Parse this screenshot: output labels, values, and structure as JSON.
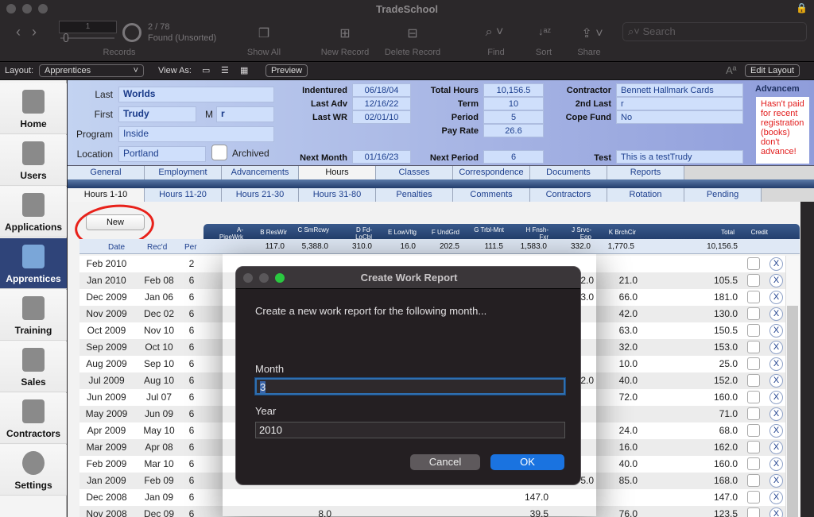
{
  "window": {
    "title": "TradeSchool"
  },
  "toolbar": {
    "record_number": "1",
    "found_count": "2 / 78",
    "found_status": "Found (Unsorted)",
    "records_label": "Records",
    "show_all_label": "Show All",
    "new_record_label": "New Record",
    "delete_record_label": "Delete Record",
    "find_label": "Find",
    "sort_label": "Sort",
    "share_label": "Share",
    "search_placeholder": "Search"
  },
  "layoutbar": {
    "layout_label": "Layout:",
    "layout_value": "Apprentices",
    "view_as_label": "View As:",
    "preview_label": "Preview",
    "edit_layout_label": "Edit Layout",
    "text_size_icon": "Aª"
  },
  "sidebar": {
    "items": [
      {
        "label": "Home",
        "icon": "house-icon"
      },
      {
        "label": "Users",
        "icon": "address-book-icon"
      },
      {
        "label": "Applications",
        "icon": "clipboard-icon"
      },
      {
        "label": "Apprentices",
        "icon": "id-badge-icon",
        "active": true
      },
      {
        "label": "Training",
        "icon": "certificate-icon"
      },
      {
        "label": "Sales",
        "icon": "basket-icon"
      },
      {
        "label": "Contractors",
        "icon": "briefcase-icon"
      },
      {
        "label": "Settings",
        "icon": "hammer-icon"
      }
    ]
  },
  "record": {
    "last_label": "Last",
    "last": "Worlds",
    "first_label": "First",
    "first": "Trudy",
    "middle_label": "M",
    "middle": "r",
    "program_label": "Program",
    "program": "Inside",
    "location_label": "Location",
    "location": "Portland",
    "archived_label": "Archived",
    "indentured_label": "Indentured",
    "indentured": "06/18/04",
    "last_adv_label": "Last Adv",
    "last_adv": "12/16/22",
    "last_wr_label": "Last WR",
    "last_wr": "02/01/10",
    "next_month_label": "Next Month",
    "next_month": "01/16/23",
    "total_hours_label": "Total Hours",
    "total_hours": "10,156.5",
    "term_label": "Term",
    "term": "10",
    "period_label": "Period",
    "period": "5",
    "pay_rate_label": "Pay Rate",
    "pay_rate": "26.6",
    "next_period_label": "Next Period",
    "next_period": "6",
    "contractor_label": "Contractor",
    "contractor": "Bennett Hallmark Cards",
    "second_last_label": "2nd Last",
    "second_last": "r",
    "cope_fund_label": "Cope Fund",
    "cope_fund": "No",
    "test_label": "Test",
    "test": "This is a testTrudy",
    "advancement_label": "Advancem",
    "advancement_note": "Hasn't paid for recent registration (books) don't advance!"
  },
  "tabs": [
    "General",
    "Employment",
    "Advancements",
    "Hours",
    "Classes",
    "Correspondence",
    "Documents",
    "Reports"
  ],
  "active_tab": "Hours",
  "subtabs": [
    "Hours 1-10",
    "Hours 11-20",
    "Hours 21-30",
    "Hours 31-80",
    "Penalties",
    "Comments",
    "Contractors",
    "Rotation",
    "Pending"
  ],
  "active_subtab": "Hours 1-10",
  "hours": {
    "new_label": "New",
    "columns": [
      "A-PipeWrk",
      "B ResWir",
      "C SmRcwy",
      "D Fd-LgCbl",
      "E LowVltg",
      "F UndGrd",
      "G Trbl-Mnt",
      "H Fnsh-Fxr",
      "J Srvc-Eqp",
      "K BrchCir",
      "Total",
      "Credit"
    ],
    "sub_headers": [
      "Date",
      "Rec'd",
      "Per"
    ],
    "totals": [
      "",
      "117.0",
      "5,388.0",
      "310.0",
      "16.0",
      "202.5",
      "111.5",
      "1,583.0",
      "332.0",
      "1,770.5",
      "10,156.5"
    ],
    "rows": [
      {
        "date": "Feb 2010",
        "recd": "",
        "per": "2",
        "j": "",
        "k": "",
        "total": ""
      },
      {
        "date": "Jan 2010",
        "recd": "Feb 08",
        "per": "6",
        "j": "2.0",
        "k": "21.0",
        "total": "105.5"
      },
      {
        "date": "Dec 2009",
        "recd": "Jan 06",
        "per": "6",
        "j": "3.0",
        "k": "66.0",
        "total": "181.0"
      },
      {
        "date": "Nov 2009",
        "recd": "Dec 02",
        "per": "6",
        "j": "",
        "k": "42.0",
        "total": "130.0"
      },
      {
        "date": "Oct 2009",
        "recd": "Nov 10",
        "per": "6",
        "j": "",
        "k": "63.0",
        "total": "150.5"
      },
      {
        "date": "Sep 2009",
        "recd": "Oct 10",
        "per": "6",
        "j": "",
        "k": "32.0",
        "total": "153.0"
      },
      {
        "date": "Aug 2009",
        "recd": "Sep 10",
        "per": "6",
        "j": "",
        "k": "10.0",
        "total": "25.0"
      },
      {
        "date": "Jul 2009",
        "recd": "Aug 10",
        "per": "6",
        "j": "2.0",
        "k": "40.0",
        "total": "152.0"
      },
      {
        "date": "Jun 2009",
        "recd": "Jul 07",
        "per": "6",
        "j": "",
        "k": "72.0",
        "total": "160.0"
      },
      {
        "date": "May 2009",
        "recd": "Jun 09",
        "per": "6",
        "j": "",
        "k": "",
        "total": "71.0"
      },
      {
        "date": "Apr 2009",
        "recd": "May 10",
        "per": "6",
        "j": "",
        "k": "24.0",
        "total": "68.0"
      },
      {
        "date": "Mar 2009",
        "recd": "Apr 08",
        "per": "6",
        "j": "",
        "k": "16.0",
        "total": "162.0"
      },
      {
        "date": "Feb 2009",
        "recd": "Mar 10",
        "per": "6",
        "j": "",
        "k": "40.0",
        "total": "160.0"
      },
      {
        "date": "Jan 2009",
        "recd": "Feb 09",
        "per": "6",
        "j": "5.0",
        "k": "85.0",
        "total": "168.0"
      },
      {
        "date": "Dec 2008",
        "recd": "Jan 09",
        "per": "6",
        "h": "147.0",
        "j": "",
        "k": "",
        "total": "147.0"
      },
      {
        "date": "Nov 2008",
        "recd": "Dec 09",
        "per": "6",
        "c": "8.0",
        "h": "39.5",
        "j": "",
        "k": "76.0",
        "total": "123.5"
      }
    ],
    "delete_icon": "Ⓧ"
  },
  "dialog": {
    "title": "Create Work Report",
    "message": "Create a new work report for the following month...",
    "month_label": "Month",
    "month_value": "3",
    "year_label": "Year",
    "year_value": "2010",
    "cancel_label": "Cancel",
    "ok_label": "OK"
  }
}
